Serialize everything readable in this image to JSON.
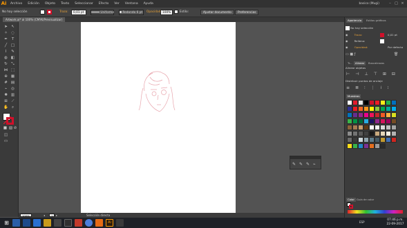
{
  "app": {
    "logo": "Ai"
  },
  "menu": [
    "Archivo",
    "Edición",
    "Objeto",
    "Texto",
    "Seleccionar",
    "Efecto",
    "Ver",
    "Ventana",
    "Ayuda"
  ],
  "user": "basico (Mugi)",
  "control": {
    "selection": "No hay selección",
    "stroke_label": "Trazo:",
    "stroke_value": "0,01 pt",
    "profile": "Uniforme",
    "brush": "Redondo 6 pt",
    "opacity_label": "Opacidad:",
    "opacity_value": "100%",
    "style_label": "Estilo:",
    "doc_setup": "Ajustar documento",
    "preferences": "Preferencias"
  },
  "doc_tab": "Artwork.ai* al 100% (CMYK/Previsualizar)",
  "status": {
    "zoom": "100%",
    "page": "1",
    "tool": "Selección directa"
  },
  "appearance_panel": {
    "tabs": [
      "Apariencia",
      "Estilos gráficos"
    ],
    "header": "No hay selección",
    "rows": [
      {
        "label": "Trazo:",
        "value": "0,01 pt"
      },
      {
        "label": "Relleno:",
        "value": ""
      },
      {
        "label": "Opacidad:",
        "value": "Por defecto"
      }
    ]
  },
  "align_panel": {
    "tabs": [
      "Tr...",
      "Alinear",
      "Buscatrazos"
    ],
    "align_label": "Alinear objetos",
    "distribute_label": "Distribuir objetos",
    "distribute_points_label": "Distribuir puntos de anclaje"
  },
  "swatches_panel": {
    "tabs": [
      "Muestras"
    ]
  },
  "bottom_panel": {
    "tabs": [
      "Color",
      "Guía de color"
    ]
  },
  "clock": {
    "time": "07:46 p.m.",
    "date": "22-09-2017",
    "lang": "ESP"
  },
  "colors": {
    "accent": "#e8a238",
    "canvas": "#535353",
    "panel": "#3c3c3c"
  }
}
